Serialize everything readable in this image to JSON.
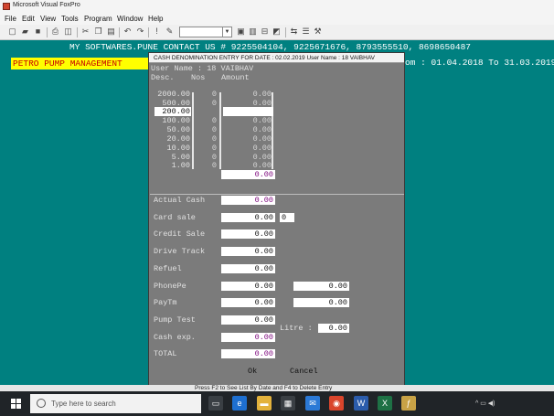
{
  "window": {
    "title": "Microsoft Visual FoxPro"
  },
  "menu": [
    "File",
    "Edit",
    "View",
    "Tools",
    "Program",
    "Window",
    "Help"
  ],
  "toolbar": {
    "icons": [
      "new-icon",
      "open-icon",
      "save-icon",
      "print-icon",
      "print-preview-icon",
      "cut-icon",
      "copy-icon",
      "paste-icon",
      "undo-icon",
      "redo-icon",
      "run-icon",
      "modify-icon"
    ],
    "combo_value": "",
    "icons_right": [
      "command-window-icon",
      "data-session-icon",
      "database-icon",
      "form-designer-icon",
      "builder-icon",
      "properties-icon",
      "tools-icon"
    ]
  },
  "screen": {
    "contact_line": "MY SOFTWARES.PUNE CONTACT US # 9225504104, 9225671676, 8793555510, 8698650487",
    "banner": "PETRO PUMP MANAGEMENT",
    "period": "om : 01.04.2018 To 31.03.2019"
  },
  "dialog": {
    "title": "CASH DENOMINATION ENTRY FOR DATE : 02.02.2019 User Name : 18 VAIBHAV",
    "user_line": "User Name : 18 VAIBHAV",
    "headers": {
      "desc": "Desc.",
      "nos": "Nos",
      "amount": "Amount"
    },
    "denominations": [
      {
        "desc": "2000.00",
        "nos": "0",
        "amount": "0.00"
      },
      {
        "desc": "500.00",
        "nos": "0",
        "amount": "0.00"
      },
      {
        "desc": "200.00",
        "nos": "",
        "amount": ""
      },
      {
        "desc": "100.00",
        "nos": "0",
        "amount": "0.00"
      },
      {
        "desc": "50.00",
        "nos": "0",
        "amount": "0.00"
      },
      {
        "desc": "20.00",
        "nos": "0",
        "amount": "0.00"
      },
      {
        "desc": "10.00",
        "nos": "0",
        "amount": "0.00"
      },
      {
        "desc": "5.00",
        "nos": "0",
        "amount": "0.00"
      },
      {
        "desc": "1.00",
        "nos": "0",
        "amount": "0.00"
      }
    ],
    "denom_total": "0.00",
    "fields": {
      "actual_cash": {
        "label": "Actual Cash",
        "value": "0.00"
      },
      "card_sale": {
        "label": "Card sale",
        "value": "0.00",
        "extra": "0"
      },
      "credit_sale": {
        "label": "Credit Sale",
        "value": "0.00"
      },
      "drive_track": {
        "label": "Drive Track",
        "value": "0.00"
      },
      "refuel": {
        "label": "Refuel",
        "value": "0.00"
      },
      "phonepe": {
        "label": "PhonePe",
        "value": "0.00",
        "extra": "0.00"
      },
      "paytm": {
        "label": "PayTm",
        "value": "0.00",
        "extra": "0.00"
      },
      "pump_test": {
        "label": "Pump Test",
        "value": "0.00"
      },
      "litre": {
        "label": "Litre :",
        "value": "0.00"
      },
      "cash_exp": {
        "label": "Cash exp.",
        "value": "0.00"
      },
      "total": {
        "label": "TOTAL",
        "value": "0.00"
      }
    },
    "ok_label": "Ok",
    "cancel_label": "Cancel"
  },
  "statusbar": {
    "text": "Press F2 to See List By Date and F4 to Delete Entry"
  },
  "taskbar": {
    "search_placeholder": "Type here to search",
    "icons": [
      "task-view-icon",
      "edge-icon",
      "file-explorer-icon",
      "store-icon",
      "mail-icon",
      "chrome-icon",
      "word-icon",
      "excel-icon",
      "foxpro-icon"
    ],
    "clock_time": "",
    "clock_date": ""
  },
  "colors": {
    "desktop": "#008080",
    "dialog": "#7b7b7b",
    "banner_bg": "#ffff00",
    "banner_text": "#c80000",
    "total_text": "#7a007a"
  }
}
